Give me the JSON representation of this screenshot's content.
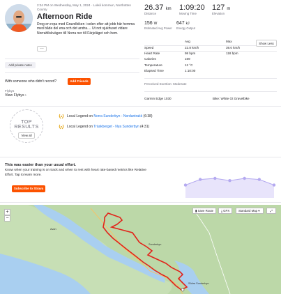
{
  "activity": {
    "meta": "2:34 PM on Wednesday, May 1, 2024 · Luleå kommun, Norrbotten County",
    "title": "Afternoon Ride",
    "description": "Drog en repa med Gravelbiken i solen efter att jobb här hemma med både del ena och det andra.... Ut not sjukhuset vidare Norrahllskvägen till Norra ner till Färjeläget och hem.",
    "more": "…"
  },
  "actions": {
    "private_notes": "Add private notes",
    "with_someone": "With someone who didn't record?",
    "add_friends": "Add Friends",
    "flyby_title": "Flybys",
    "view_flybys": "View Flybys ›"
  },
  "stats": {
    "distance": {
      "value": "26.37",
      "unit": "km",
      "label": "Distance"
    },
    "moving_time": {
      "value": "1:09:20",
      "label": "Moving Time"
    },
    "elevation": {
      "value": "127",
      "unit": "m",
      "label": "Elevation"
    },
    "est_power": {
      "value": "156",
      "unit": "W",
      "label": "Estimated Avg Power"
    },
    "energy": {
      "value": "647",
      "unit": "kJ",
      "label": "Energy Output"
    }
  },
  "table": {
    "headers": [
      "",
      "Avg",
      "Max"
    ],
    "rows": [
      [
        "Speed",
        "22.8 km/h",
        "39.0 km/h"
      ],
      [
        "Heart Rate",
        "98 bpm",
        "118 bpm"
      ],
      [
        "Calories",
        "169",
        ""
      ],
      [
        "Temperature",
        "12 °C",
        ""
      ],
      [
        "Elapsed Time",
        "1:10:00",
        ""
      ]
    ],
    "show_less": "Show Less"
  },
  "perceived": "Perceived Exertion: Moderate",
  "device": "Garmin Edge 1030",
  "bike": "Bike: White Gt Gravelbike",
  "top_results": {
    "title": "TOP RESULTS",
    "view_all": "View all",
    "items": [
      {
        "pre": "Local Legend on ",
        "link": "Norra Sunderbyn - Nordantrakk",
        "post": " (6:38)"
      },
      {
        "pre": "Local Legend on ",
        "link": "Träskberget - Nya Sunderbyn",
        "post": " (4:31)"
      }
    ]
  },
  "relative_effort": {
    "heading": "This was easier than your usual effort.",
    "body": "Know when your training is on track and when to rest with heart rate-based metrics like Relative Effort. Tap to learn more.",
    "subscribe": "Subscribe to Strava",
    "chart_points": [
      0.55,
      0.3,
      0.25,
      0.35,
      0.25,
      0.3,
      0.55
    ],
    "accent": "#b4a9f0"
  },
  "map": {
    "save_route": "Save Route",
    "gpx": "GPX",
    "style": "Standard Map",
    "zoom_in": "+",
    "zoom_out": "−",
    "labels": [
      "Avan",
      "Sunderbyn",
      "Södra Sunderbyn"
    ],
    "route_color": "#e2231a",
    "water_color": "#a9cff0"
  }
}
